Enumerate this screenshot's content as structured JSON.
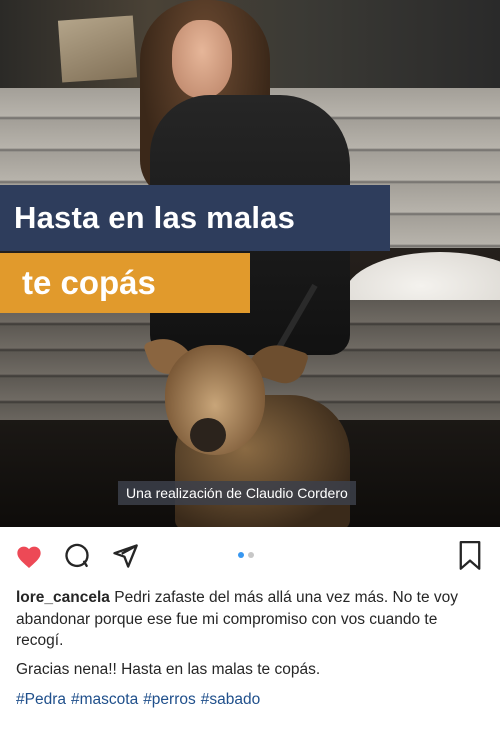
{
  "post": {
    "overlay_line1": "Hasta en las malas",
    "overlay_line2": "te copás",
    "credit": "Una realización de Claudio Cordero"
  },
  "actions": {
    "like_icon": "heart-filled-icon",
    "comment_icon": "comment-icon",
    "share_icon": "paper-plane-icon",
    "save_icon": "bookmark-icon",
    "like_color": "#ed4956",
    "carousel_active_color": "#3897f0",
    "carousel_inactive_color": "#c7c7c7",
    "carousel_count": 2,
    "carousel_active_index": 0
  },
  "caption": {
    "username": "lore_cancela",
    "text": "Pedri zafaste del más allá una vez más. No te voy abandonar porque ese fue mi compromiso con vos cuando te recogí.",
    "reply": "Gracias nena!! Hasta en las malas te copás.",
    "hashtags": [
      "#Pedra",
      "#mascota",
      "#perros",
      "#sabado"
    ],
    "hashtag_color": "#1f4f8b"
  }
}
